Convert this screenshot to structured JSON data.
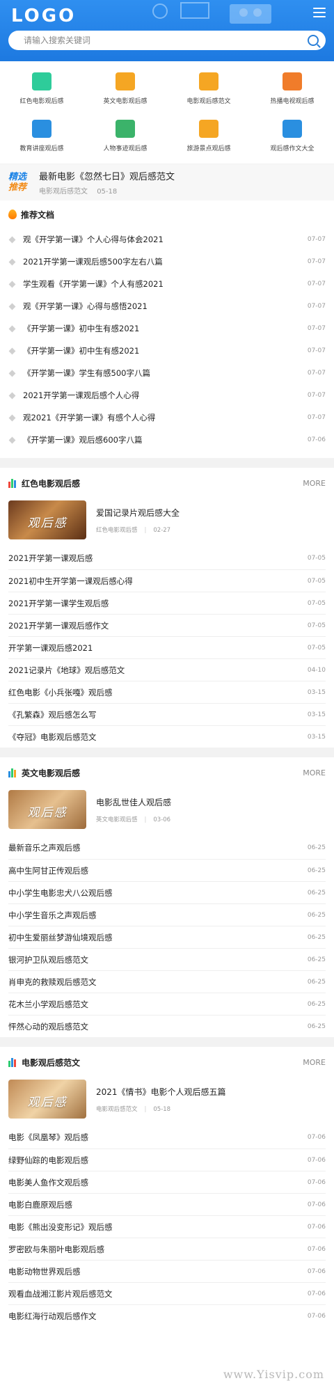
{
  "header": {
    "logo": "LOGO",
    "search_placeholder": "请输入搜索关键词"
  },
  "categories": [
    {
      "label": "红色电影观后感",
      "icon": "document-icon",
      "color": "#2ecc9a"
    },
    {
      "label": "英文电影观后感",
      "icon": "monitor-icon",
      "color": "#f5a623"
    },
    {
      "label": "电影观后感范文",
      "icon": "lightbulb-icon",
      "color": "#f5a623"
    },
    {
      "label": "热播电视观后感",
      "icon": "stack-icon",
      "color": "#f07c2a"
    },
    {
      "label": "教育讲座观后感",
      "icon": "globe-icon",
      "color": "#2a8fe0"
    },
    {
      "label": "人物事迹观后感",
      "icon": "books-icon",
      "color": "#3bb36a"
    },
    {
      "label": "旅游景点观后感",
      "icon": "calendar-icon",
      "color": "#f5a623"
    },
    {
      "label": "观后感作文大全",
      "icon": "chart-icon",
      "color": "#2a8fe0"
    }
  ],
  "featured": {
    "badge_top": "精选",
    "badge_bottom": "推荐",
    "title": "最新电影《忽然七日》观后感范文",
    "category": "电影观后感范文",
    "date": "05-18"
  },
  "recommended": {
    "title": "推荐文档",
    "items": [
      {
        "title": "观《开学第一课》个人心得与体会2021",
        "date": "07-07"
      },
      {
        "title": "2021开学第一课观后感500字左右八篇",
        "date": "07-07"
      },
      {
        "title": "学生观看《开学第一课》个人有感2021",
        "date": "07-07"
      },
      {
        "title": "观《开学第一课》心得与感悟2021",
        "date": "07-07"
      },
      {
        "title": "《开学第一课》初中生有感2021",
        "date": "07-07"
      },
      {
        "title": "《开学第一课》初中生有感2021",
        "date": "07-07"
      },
      {
        "title": "《开学第一课》学生有感500字八篇",
        "date": "07-07"
      },
      {
        "title": "2021开学第一课观后感个人心得",
        "date": "07-07"
      },
      {
        "title": "观2021《开学第一课》有感个人心得",
        "date": "07-07"
      },
      {
        "title": "《开学第一课》观后感600字八篇",
        "date": "07-06"
      }
    ]
  },
  "sections": [
    {
      "title": "红色电影观后感",
      "more": "MORE",
      "hero": {
        "thumb_text": "观后感",
        "title": "爱国记录片观后感大全",
        "category": "红色电影观后感",
        "sep": "|",
        "date": "02-27"
      },
      "items": [
        {
          "title": "2021开学第一课观后感",
          "date": "07-05"
        },
        {
          "title": "2021初中生开学第一课观后感心得",
          "date": "07-05"
        },
        {
          "title": "2021开学第一课学生观后感",
          "date": "07-05"
        },
        {
          "title": "2021开学第一课观后感作文",
          "date": "07-05"
        },
        {
          "title": "开学第一课观后感2021",
          "date": "07-05"
        },
        {
          "title": "2021记录片《地球》观后感范文",
          "date": "04-10"
        },
        {
          "title": "红色电影《小兵张嘎》观后感",
          "date": "03-15"
        },
        {
          "title": "《孔繁森》观后感怎么写",
          "date": "03-15"
        },
        {
          "title": "《夺冠》电影观后感范文",
          "date": "03-15"
        }
      ]
    },
    {
      "title": "英文电影观后感",
      "more": "MORE",
      "hero": {
        "thumb_text": "观后感",
        "title": "电影乱世佳人观后感",
        "category": "英文电影观后感",
        "sep": "|",
        "date": "03-06"
      },
      "items": [
        {
          "title": "最新音乐之声观后感",
          "date": "06-25"
        },
        {
          "title": "高中生阿甘正传观后感",
          "date": "06-25"
        },
        {
          "title": "中小学生电影忠犬八公观后感",
          "date": "06-25"
        },
        {
          "title": "中小学生音乐之声观后感",
          "date": "06-25"
        },
        {
          "title": "初中生爱丽丝梦游仙境观后感",
          "date": "06-25"
        },
        {
          "title": "银河护卫队观后感范文",
          "date": "06-25"
        },
        {
          "title": "肖申克的救赎观后感范文",
          "date": "06-25"
        },
        {
          "title": "花木兰小学观后感范文",
          "date": "06-25"
        },
        {
          "title": "怦然心动的观后感范文",
          "date": "06-25"
        }
      ]
    },
    {
      "title": "电影观后感范文",
      "more": "MORE",
      "hero": {
        "thumb_text": "观后感",
        "title": "2021《情书》电影个人观后感五篇",
        "category": "电影观后感范文",
        "sep": "|",
        "date": "05-18"
      },
      "items": [
        {
          "title": "电影《凤凰琴》观后感",
          "date": "07-06"
        },
        {
          "title": "绿野仙踪的电影观后感",
          "date": "07-06"
        },
        {
          "title": "电影美人鱼作文观后感",
          "date": "07-06"
        },
        {
          "title": "电影白鹿原观后感",
          "date": "07-06"
        },
        {
          "title": "电影《熊出没变形记》观后感",
          "date": "07-06"
        },
        {
          "title": "罗密欧与朱丽叶电影观后感",
          "date": "07-06"
        },
        {
          "title": "电影动物世界观后感",
          "date": "07-06"
        },
        {
          "title": "观看血战湘江影片观后感范文",
          "date": "07-06"
        },
        {
          "title": "电影红海行动观后感作文",
          "date": "07-06"
        }
      ]
    }
  ],
  "watermark": "www.Yisvip.com"
}
